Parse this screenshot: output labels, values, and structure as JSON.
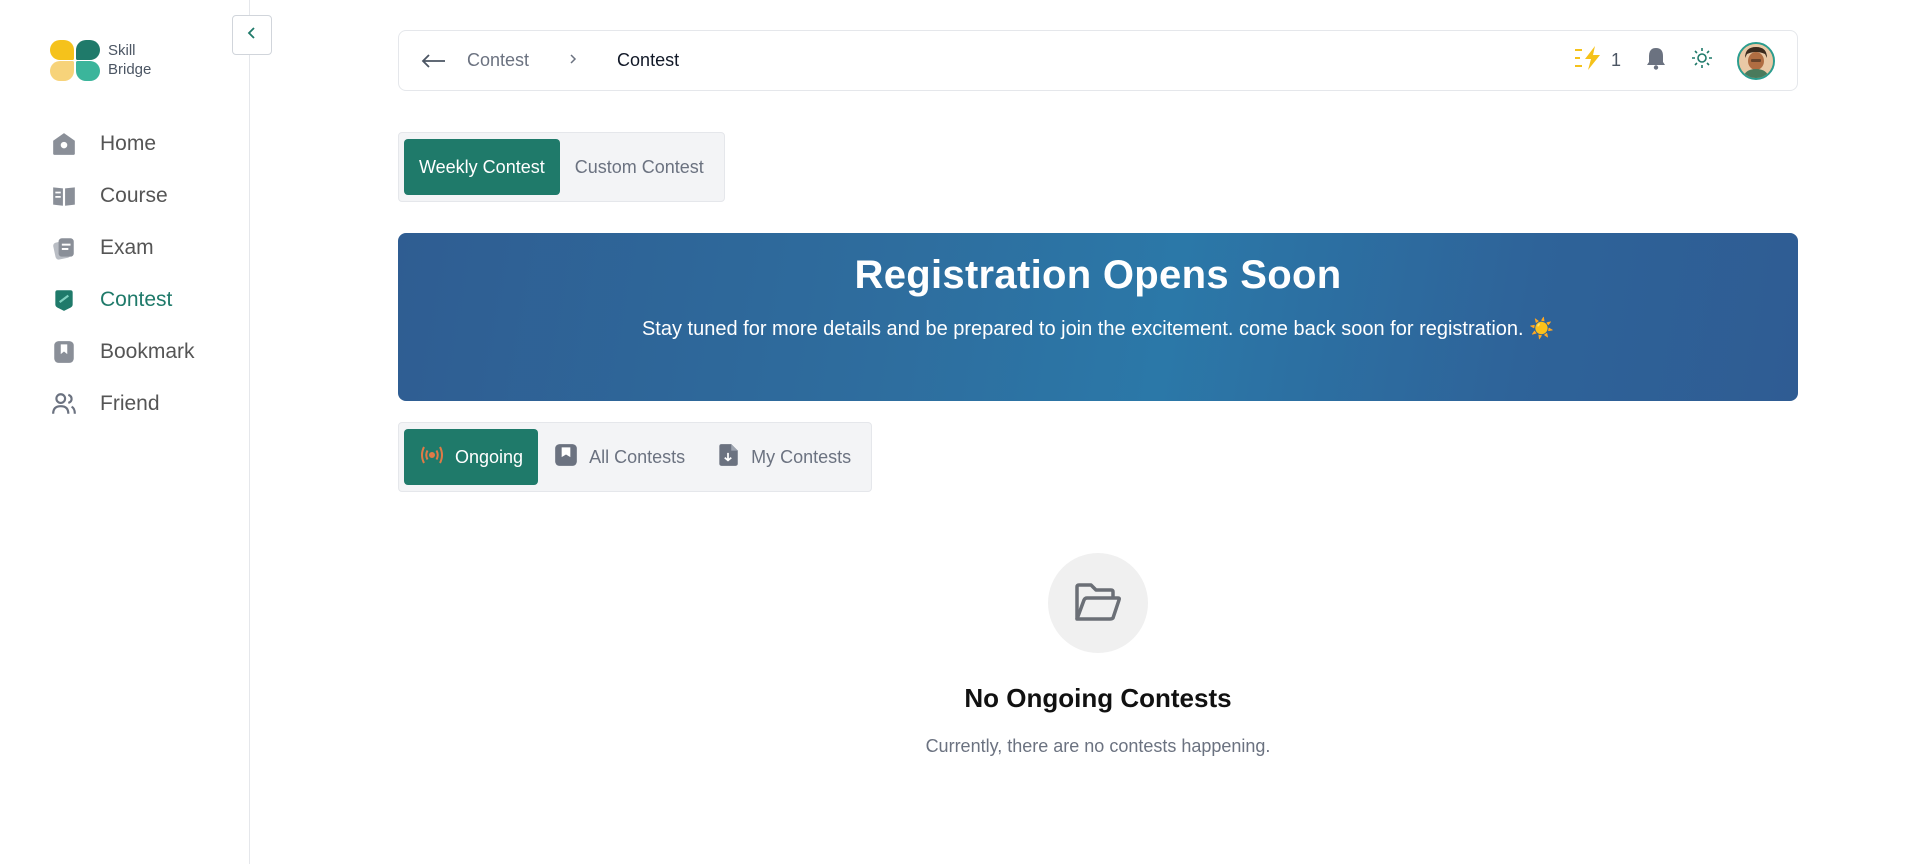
{
  "brand": {
    "line1": "Skill",
    "line2": "Bridge"
  },
  "colors": {
    "accent": "#1f7a6a",
    "banner": "#2e6d9e",
    "streak": "#f5c21b"
  },
  "sidebar": {
    "items": [
      {
        "label": "Home",
        "icon": "home-icon"
      },
      {
        "label": "Course",
        "icon": "book-open-icon"
      },
      {
        "label": "Exam",
        "icon": "exam-icon"
      },
      {
        "label": "Contest",
        "icon": "contest-icon",
        "active": true
      },
      {
        "label": "Bookmark",
        "icon": "bookmark-icon"
      },
      {
        "label": "Friend",
        "icon": "users-icon"
      }
    ]
  },
  "breadcrumb": {
    "back_icon": "arrow-left-icon",
    "parent": "Contest",
    "current": "Contest"
  },
  "header": {
    "streak_count": "1"
  },
  "contest_types": {
    "weekly": "Weekly Contest",
    "custom": "Custom Contest",
    "active": "weekly"
  },
  "banner": {
    "title": "Registration Opens Soon",
    "message": "Stay tuned for more details and be prepared to join the excitement. come back soon for registration. ☀️"
  },
  "status_tabs": {
    "ongoing": "Ongoing",
    "all": "All Contests",
    "mine": "My Contests",
    "active": "ongoing"
  },
  "empty_state": {
    "title": "No Ongoing Contests",
    "message": "Currently, there are no contests happening."
  }
}
